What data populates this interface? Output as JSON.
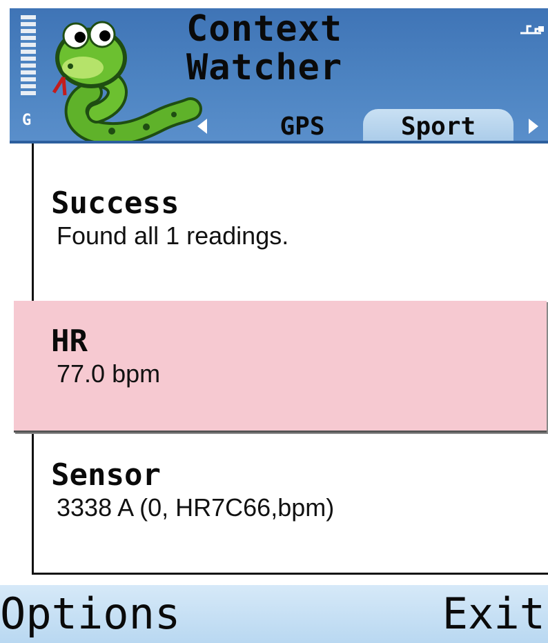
{
  "status": {
    "network_letter": "G",
    "signal_icon": "signal-strength-icon",
    "connectivity_icon": "usb-connection-icon"
  },
  "app": {
    "title_line1": "Context",
    "title_line2": "Watcher",
    "logo_icon": "snake-mascot-icon"
  },
  "tabs": {
    "items": [
      {
        "label": "GPS",
        "selected": false
      },
      {
        "label": "Sport",
        "selected": true
      }
    ],
    "left_arrow_icon": "arrow-left-icon",
    "right_arrow_icon": "arrow-right-icon"
  },
  "list": {
    "items": [
      {
        "title": "Success",
        "value": "Found all 1 readings."
      },
      {
        "title": "HR",
        "value": "77.0 bpm",
        "highlighted": true
      },
      {
        "title": "Sensor",
        "value": "3338 A (0, HR7C66,bpm)"
      }
    ]
  },
  "softkeys": {
    "left_label": "Options",
    "right_label": "Exit"
  },
  "colors": {
    "header_blue": "#4d84c2",
    "tab_selected": "#b9d6ee",
    "highlight_pink": "#f6c9d1",
    "softkey_bg": "#c8e1f5"
  }
}
